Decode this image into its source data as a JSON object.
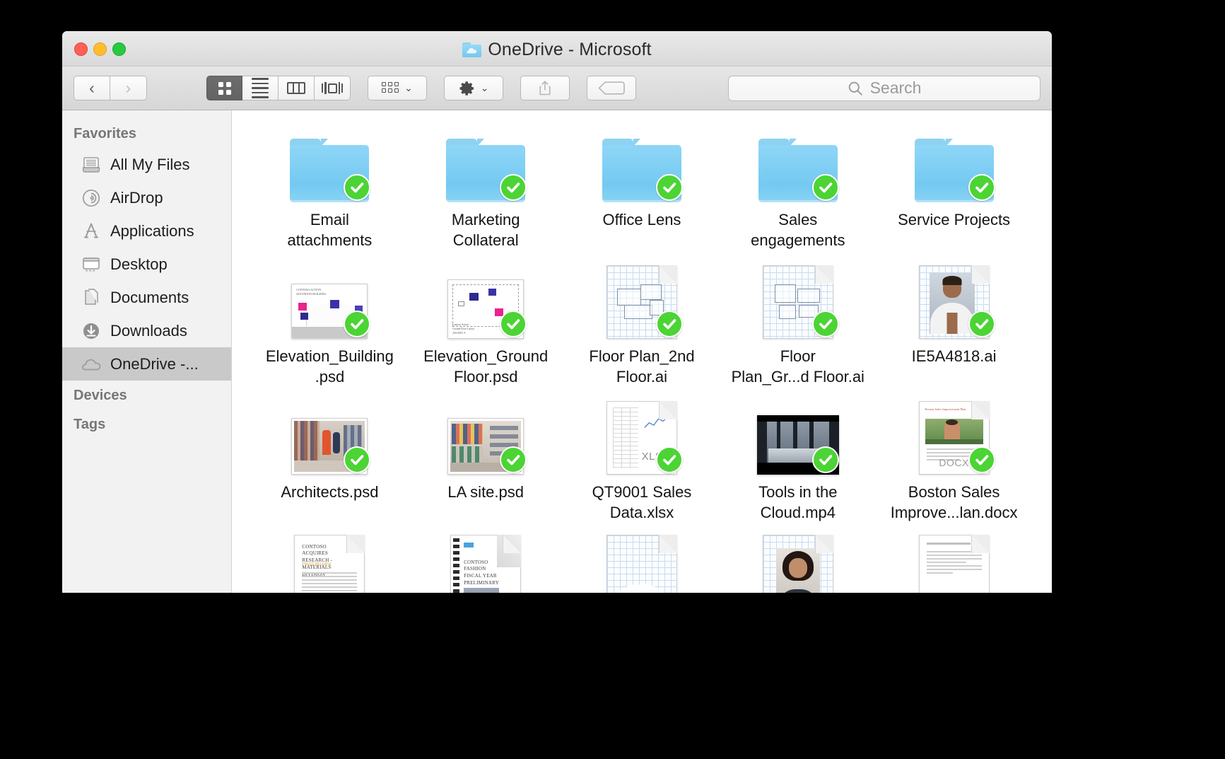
{
  "window": {
    "title": "OneDrive - Microsoft",
    "title_icon": "onedrive-folder-cloud-icon",
    "traffic_lights": [
      "close-button",
      "minimize-button",
      "zoom-button"
    ]
  },
  "toolbar": {
    "back_label": "‹",
    "forward_label": "›",
    "view_buttons": [
      {
        "name": "icon-view",
        "icon": "grid-icon",
        "active": true
      },
      {
        "name": "list-view",
        "icon": "list-icon",
        "active": false
      },
      {
        "name": "column-view",
        "icon": "columns-icon",
        "active": false
      },
      {
        "name": "cover-flow-view",
        "icon": "coverflow-icon",
        "active": false
      }
    ],
    "arrange_label": "arrange-icon",
    "action_label": "gear-icon",
    "share_label": "share-icon",
    "tag_label": "tag-icon",
    "caret_glyph": "⌄"
  },
  "search": {
    "placeholder": "Search",
    "value": "",
    "icon": "search-icon"
  },
  "sidebar": {
    "sections": [
      {
        "header": "Favorites",
        "items": [
          {
            "label": "All My Files",
            "icon": "all-my-files-icon",
            "selected": false
          },
          {
            "label": "AirDrop",
            "icon": "airdrop-icon",
            "selected": false
          },
          {
            "label": "Applications",
            "icon": "applications-icon",
            "selected": false
          },
          {
            "label": "Desktop",
            "icon": "desktop-icon",
            "selected": false
          },
          {
            "label": "Documents",
            "icon": "documents-icon",
            "selected": false
          },
          {
            "label": "Downloads",
            "icon": "downloads-icon",
            "selected": false
          },
          {
            "label": "OneDrive -...",
            "icon": "cloud-icon",
            "selected": true
          }
        ]
      },
      {
        "header": "Devices",
        "items": []
      },
      {
        "header": "Tags",
        "items": []
      }
    ]
  },
  "files": [
    {
      "name": "Email\nattachments",
      "kind": "folder",
      "synced": true
    },
    {
      "name": "Marketing\nCollateral",
      "kind": "folder",
      "synced": true
    },
    {
      "name": "Office Lens",
      "kind": "folder",
      "synced": true
    },
    {
      "name": "Sales\nengagements",
      "kind": "folder",
      "synced": true
    },
    {
      "name": "Service Projects",
      "kind": "folder",
      "synced": true
    },
    {
      "name": "Elevation_Building\n.psd",
      "kind": "psd-elevation",
      "synced": true
    },
    {
      "name": "Elevation_Ground\nFloor.psd",
      "kind": "psd-plan",
      "synced": true
    },
    {
      "name": "Floor Plan_2nd\nFloor.ai",
      "kind": "ai-blueprint",
      "synced": true
    },
    {
      "name": "Floor\nPlan_Gr...d Floor.ai",
      "kind": "ai-blueprint",
      "synced": true
    },
    {
      "name": "IE5A4818.ai",
      "kind": "ai-portrait-m",
      "synced": true
    },
    {
      "name": "Architects.psd",
      "kind": "photo-retail1",
      "synced": true
    },
    {
      "name": "LA site.psd",
      "kind": "photo-retail2",
      "synced": true
    },
    {
      "name": "QT9001 Sales\nData.xlsx",
      "kind": "xlsx",
      "synced": true,
      "badge_text": "XLSX"
    },
    {
      "name": "Tools in the\nCloud.mp4",
      "kind": "mp4",
      "synced": true
    },
    {
      "name": "Boston Sales\nImprove...lan.docx",
      "kind": "docx",
      "synced": true,
      "badge_text": "DOCX"
    },
    {
      "name": "",
      "kind": "doc-report",
      "synced": false,
      "doc_title": "Contoso Acquires Research - Materials Division"
    },
    {
      "name": "",
      "kind": "doc-booklet",
      "synced": false,
      "doc_title": "Contoso Fashion Fiscal Year Preliminary Budget Plan"
    },
    {
      "name": "",
      "kind": "ai-blueprint2",
      "synced": false
    },
    {
      "name": "",
      "kind": "ai-portrait-f",
      "synced": false
    },
    {
      "name": "",
      "kind": "doc-plain",
      "synced": false
    }
  ],
  "colors": {
    "folder_blue": "#7ecdf2",
    "sync_green": "#4cd435",
    "selection_gray": "#c9c9c9",
    "window_chrome": "#e6e6e6",
    "text": "#141414"
  }
}
